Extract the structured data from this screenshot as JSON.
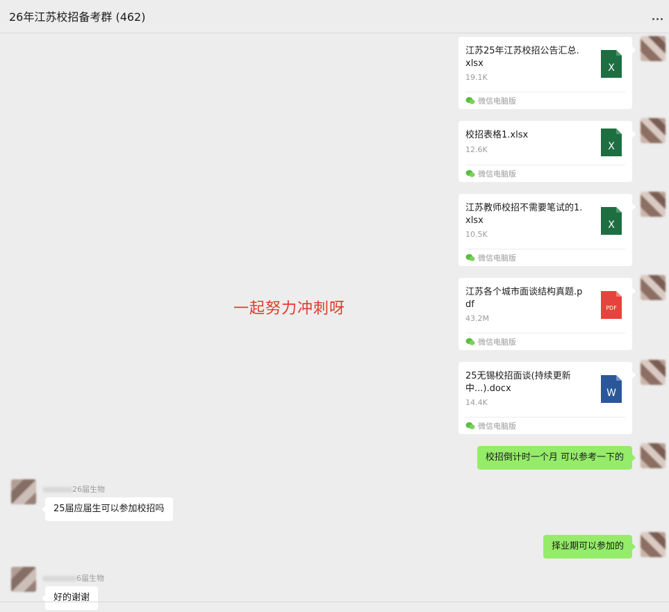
{
  "header": {
    "title": "26年江苏校招备考群 (462)",
    "more_icon": "more-dots-icon"
  },
  "overlay_text": "一起努力冲刺呀",
  "colors": {
    "background": "#ededed",
    "self_bubble": "#95ec69",
    "other_bubble": "#ffffff",
    "overlay_text": "#e03a2a",
    "excel": "#1d6f42",
    "pdf": "#e5433b",
    "word": "#2b579a",
    "wechat": "#58bf3c"
  },
  "messages": [
    {
      "type": "file",
      "sender": "self",
      "file_name": "江苏25年江苏校招公告汇总.xlsx",
      "size": "19.1K",
      "file_type": "xlsx",
      "icon_letter": "X",
      "source": "微信电脑版"
    },
    {
      "type": "file",
      "sender": "self",
      "file_name": "校招表格1.xlsx",
      "size": "12.6K",
      "file_type": "xlsx",
      "icon_letter": "X",
      "source": "微信电脑版"
    },
    {
      "type": "file",
      "sender": "self",
      "file_name": "江苏教师校招不需要笔试的1.xlsx",
      "size": "10.5K",
      "file_type": "xlsx",
      "icon_letter": "X",
      "source": "微信电脑版"
    },
    {
      "type": "file",
      "sender": "self",
      "file_name": "江苏各个城市面谈结构真题.pdf",
      "size": "43.2M",
      "file_type": "pdf",
      "icon_letter": "PDF",
      "source": "微信电脑版"
    },
    {
      "type": "file",
      "sender": "self",
      "file_name": "25无锡校招面谈(持续更新中...).docx",
      "size": "14.4K",
      "file_type": "docx",
      "icon_letter": "W",
      "source": "微信电脑版"
    },
    {
      "type": "text",
      "sender": "self",
      "text": "校招倒计时一个月 可以参考一下的"
    },
    {
      "type": "text",
      "sender": "other",
      "sender_name": "26届生物",
      "text": "25届应届生可以参加校招吗"
    },
    {
      "type": "text",
      "sender": "self",
      "text": "择业期可以参加的"
    },
    {
      "type": "text",
      "sender": "other",
      "sender_name": "6届生物",
      "text": "好的谢谢"
    }
  ]
}
